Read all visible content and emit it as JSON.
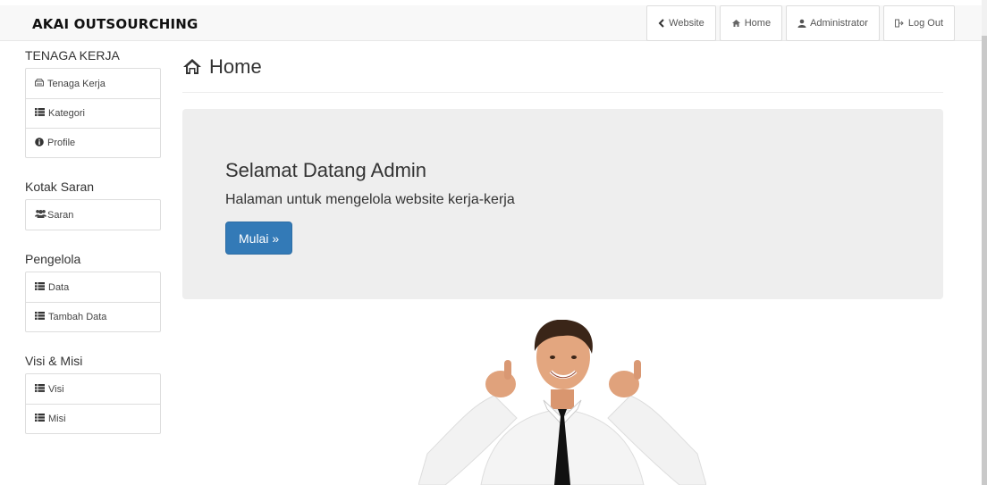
{
  "brand": "AKAI OUTSOURCHING",
  "nav": {
    "website": "Website",
    "home": "Home",
    "administrator": "Administrator",
    "logout": "Log Out"
  },
  "sidebar": {
    "sections": [
      {
        "title": "TENAGA KERJA",
        "items": [
          "Tenaga Kerja",
          "Kategori",
          "Profile"
        ]
      },
      {
        "title": "Kotak Saran",
        "items": [
          "Saran"
        ]
      },
      {
        "title": "Pengelola",
        "items": [
          "Data",
          "Tambah Data"
        ]
      },
      {
        "title": "Visi & Misi",
        "items": [
          "Visi",
          "Misi"
        ]
      }
    ]
  },
  "main": {
    "title": "Home",
    "jumbotron": {
      "heading": "Selamat Datang Admin",
      "text": "Halaman untuk mengelola website kerja-kerja",
      "button": "Mulai »"
    }
  },
  "colors": {
    "primary": "#337ab7",
    "jumbotron_bg": "#eeeeee",
    "navbar_bg": "#f8f8f8"
  },
  "icons": {
    "website": "chevron-left-icon",
    "home": "home-icon",
    "administrator": "user-icon",
    "logout": "logout-icon",
    "tenaga_kerja": "hdd-icon",
    "list": "list-icon",
    "profile": "info-icon",
    "saran": "users-icon"
  }
}
